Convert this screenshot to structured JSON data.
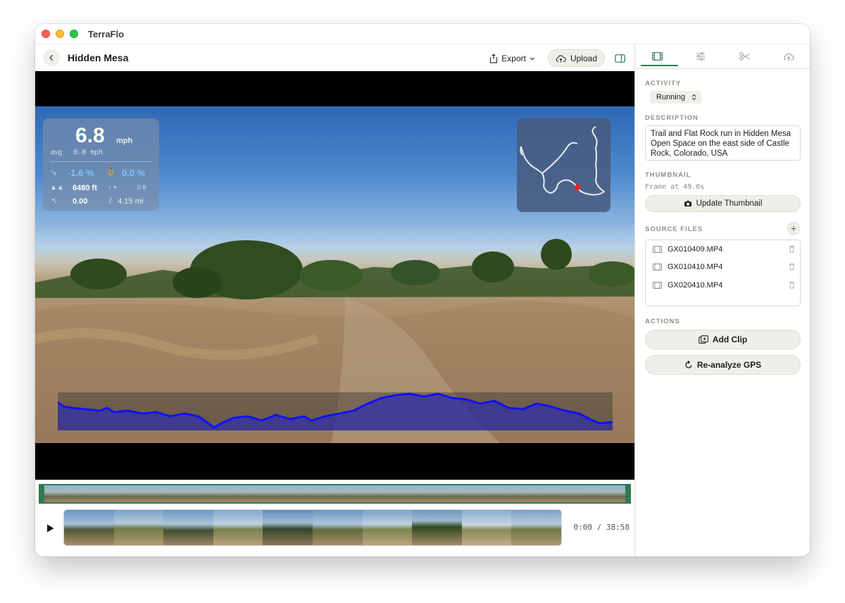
{
  "app": {
    "title": "TerraFlo"
  },
  "toolbar": {
    "title": "Hidden Mesa",
    "export_label": "Export",
    "upload_label": "Upload"
  },
  "overlay": {
    "speed": {
      "value": "6.8",
      "unit": "mph",
      "avg_label": "avg",
      "avg_value": "0.0 mph"
    },
    "grade": {
      "value": "-1.6 %",
      "other": "0.0 %"
    },
    "elevation": {
      "value": "6480 ft",
      "gain": "0 ft"
    },
    "distance": {
      "current": "0.00",
      "total": "4.15 mi"
    }
  },
  "timeline": {
    "time_display": "0:00 / 38:58",
    "thumbnail_count": 10
  },
  "sidebar": {
    "tabs": [
      {
        "name": "video-tab",
        "icon": "film-icon",
        "active": true
      },
      {
        "name": "adjust-tab",
        "icon": "sliders-icon",
        "active": false
      },
      {
        "name": "trim-tab",
        "icon": "scissors-icon",
        "active": false
      },
      {
        "name": "upload-tab",
        "icon": "cloud-upload-icon",
        "active": false
      }
    ],
    "activity": {
      "label": "ACTIVITY",
      "value": "Running"
    },
    "description": {
      "label": "DESCRIPTION",
      "text": "Trail and Flat Rock run in Hidden Mesa Open Space on the east side of Castle Rock, Colorado, USA"
    },
    "thumbnail": {
      "label": "THUMBNAIL",
      "frame": "Frame at 49.0s",
      "button": "Update Thumbnail"
    },
    "source_files": {
      "label": "SOURCE FILES",
      "files": [
        "GX010409.MP4",
        "GX010410.MP4",
        "GX020410.MP4"
      ]
    },
    "actions": {
      "label": "ACTIONS",
      "add_clip": "Add Clip",
      "reanalyze": "Re-analyze GPS"
    }
  },
  "colors": {
    "accent": "#2f7a50",
    "elevation_line": "#1010ff",
    "grade_text": "#7cc6ff",
    "position_marker": "#ff1a1a"
  }
}
